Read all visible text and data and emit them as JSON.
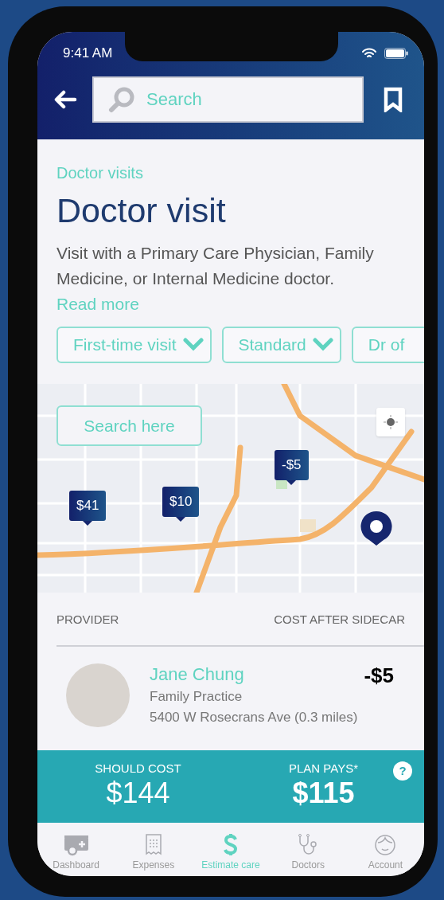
{
  "status_bar": {
    "time": "9:41 AM"
  },
  "header": {
    "search": {
      "placeholder": "Search"
    }
  },
  "category": "Doctor visits",
  "title": "Doctor visit",
  "description": "Visit with a Primary Care Physician, Family Medicine, or Internal Medicine doctor.",
  "read_more": "Read more",
  "filters": [
    {
      "label": "First-time visit",
      "dropdown": true
    },
    {
      "label": "Standard",
      "dropdown": true
    },
    {
      "label": "Dr of",
      "dropdown": false
    }
  ],
  "map": {
    "search_button": "Search here",
    "markers": [
      {
        "label": "$41"
      },
      {
        "label": "$10"
      },
      {
        "label": "-$5"
      }
    ]
  },
  "table": {
    "columns": [
      "PROVIDER",
      "COST AFTER SIDECAR"
    ],
    "rows": [
      {
        "name": "Jane Chung",
        "specialty": "Family Practice",
        "address": "5400 W Rosecrans Ave (0.3 miles)",
        "cost": "-$5"
      }
    ]
  },
  "summary": {
    "should_cost_label": "SHOULD COST",
    "should_cost": "$144",
    "plan_pays_label": "PLAN PAYS*",
    "plan_pays": "$115",
    "help": "?"
  },
  "tabs": [
    {
      "label": "Dashboard",
      "kind": "dashboard",
      "selected": false
    },
    {
      "label": "Expenses",
      "kind": "expenses",
      "selected": false
    },
    {
      "label": "Estimate care",
      "kind": "estimate",
      "selected": true
    },
    {
      "label": "Doctors",
      "kind": "doctors",
      "selected": false
    },
    {
      "label": "Account",
      "kind": "account",
      "selected": false
    }
  ]
}
